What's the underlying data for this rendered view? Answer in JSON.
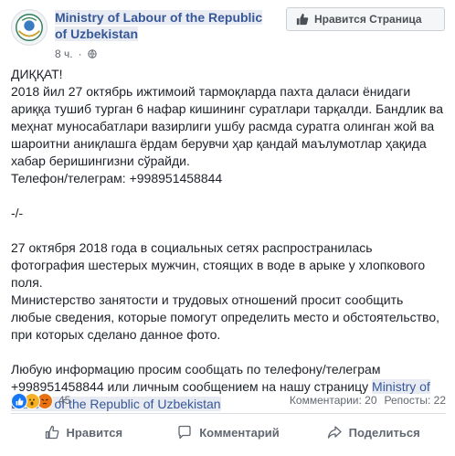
{
  "header": {
    "page_name_line1": "Ministry of Labour of the Republic",
    "page_name_line2": "of Uzbekistan",
    "time": "8 ч.",
    "like_page_label": "Нравится Страница"
  },
  "post": {
    "uz_block": [
      "ДИҚҚАТ!",
      "2018 йил 27 октябрь ижтимоий тармоқларда пахта даласи ёнидаги",
      "ариққа тушиб турган 6 нафар кишининг суратлари тарқалди. Бандлик ва",
      "меҳнат муносабатлари вазирлиги ушбу расмда суратга олинган жой ва",
      "шароитни аниқлашга ёрдам берувчи ҳар қандай маълумотлар ҳақида",
      "хабар беришингизни сўрайди.",
      "Телефон/телеграм: +998951458844"
    ],
    "separator": "-/-",
    "ru_block": [
      "27 октября 2018 года в социальных сетях распространилась",
      "фотография шестерых мужчин, стоящих в воде в арыке у хлопкового",
      "поля.",
      "Министерство занятости и трудовых отношений просит сообщить",
      "любые сведения, которые помогут определить место и обстоятельство,",
      "при которых сделано данное фото."
    ],
    "contact_block": {
      "line1": "Любую информацию просим сообщать по телефону/телеграм",
      "line2_text": "+998951458844 или личным сообщением на нашу страницу",
      "mention_part1": "Ministry of",
      "mention_part2": "Labour of the Republic of Uzbekistan"
    }
  },
  "reactions": {
    "count": "45",
    "comments": "Комментарии: 20",
    "shares": "Репосты: 22"
  },
  "actions": {
    "like": "Нравится",
    "comment": "Комментарий",
    "share": "Поделиться"
  },
  "colors": {
    "link": "#365899",
    "like_blue": "#1877f2",
    "text": "#1d2129",
    "muted": "#616770"
  }
}
